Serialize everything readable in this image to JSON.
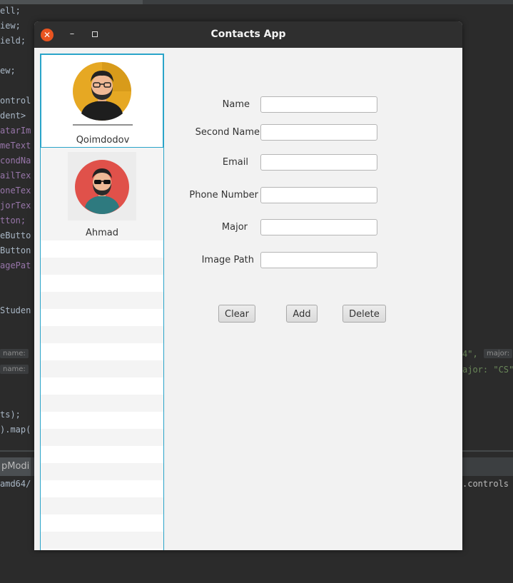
{
  "ide": {
    "left_code_lines": [
      "ell;",
      "iew;",
      "ield;",
      "",
      "ew;",
      "",
      "ontrol",
      "dent>",
      "atarIm",
      "meText",
      "condNa",
      "ailTex",
      "oneTex",
      "jorTex",
      "tton;",
      "eButto",
      "Button",
      "agePat",
      "",
      "",
      "Studen",
      "",
      "",
      "",
      "",
      "",
      "ts);",
      ").map(",
      "",
      "",
      "amd64/"
    ],
    "chip_name": "name:",
    "right_line_1": "4\",",
    "right_chip_major": "major:",
    "right_line_2": "ajor: \"CS\",",
    "bottom_tab": "pModi",
    "right_bottom": ".controls"
  },
  "window": {
    "title": "Contacts App",
    "close_glyph": "✕",
    "minimize_glyph": "–"
  },
  "contacts": [
    {
      "name": "Qoimdodov",
      "avatar": "bearded-man-glasses-yellow-avatar"
    },
    {
      "name": "Ahmad",
      "avatar": "bearded-man-sunglasses-red-avatar"
    }
  ],
  "form": {
    "name_label": "Name",
    "second_name_label": "Second Name",
    "email_label": "Email",
    "phone_label": "Phone Number",
    "major_label": "Major",
    "image_path_label": "Image Path",
    "name_value": "",
    "second_name_value": "",
    "email_value": "",
    "phone_value": "",
    "major_value": "",
    "image_path_value": ""
  },
  "buttons": {
    "clear": "Clear",
    "add": "Add",
    "delete": "Delete"
  },
  "colors": {
    "accent": "#2aa4c9",
    "close": "#e95420",
    "titlebar": "#2f2f2f",
    "avatar1_bg": "#e6a823",
    "avatar2_bg": "#e0514a"
  }
}
